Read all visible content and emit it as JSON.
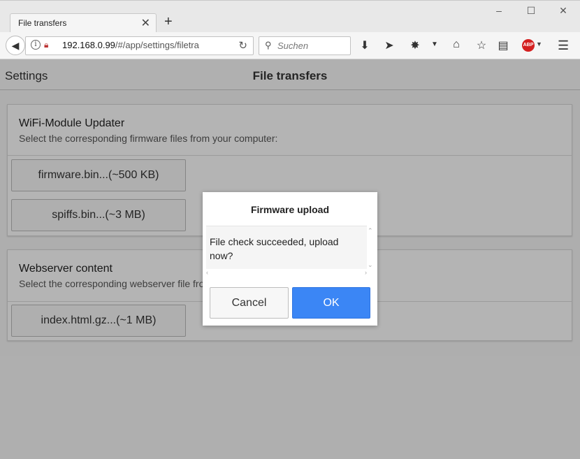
{
  "browser": {
    "tab_title": "File transfers",
    "new_tab": "+",
    "url_host": "192.168.0.99",
    "url_path": "/#/app/settings/filetra",
    "search_placeholder": "Suchen",
    "abp_label": "ABP"
  },
  "appbar": {
    "back_label": "Settings",
    "title": "File transfers"
  },
  "wifi_card": {
    "title": "WiFi-Module Updater",
    "subtitle": "Select the corresponding firmware files from your computer:",
    "buttons": [
      "firmware.bin...(~500 KB)",
      "spiffs.bin...(~3 MB)"
    ]
  },
  "web_card": {
    "title": "Webserver content",
    "subtitle": "Select the corresponding webserver file from your computer:",
    "buttons": [
      "index.html.gz...(~1 MB)"
    ]
  },
  "dialog": {
    "title": "Firmware upload",
    "message": "File check succeeded, upload now?",
    "cancel_label": "Cancel",
    "ok_label": "OK"
  },
  "colors": {
    "ok_button": "#3b86f5",
    "abp_badge": "#d42020"
  }
}
